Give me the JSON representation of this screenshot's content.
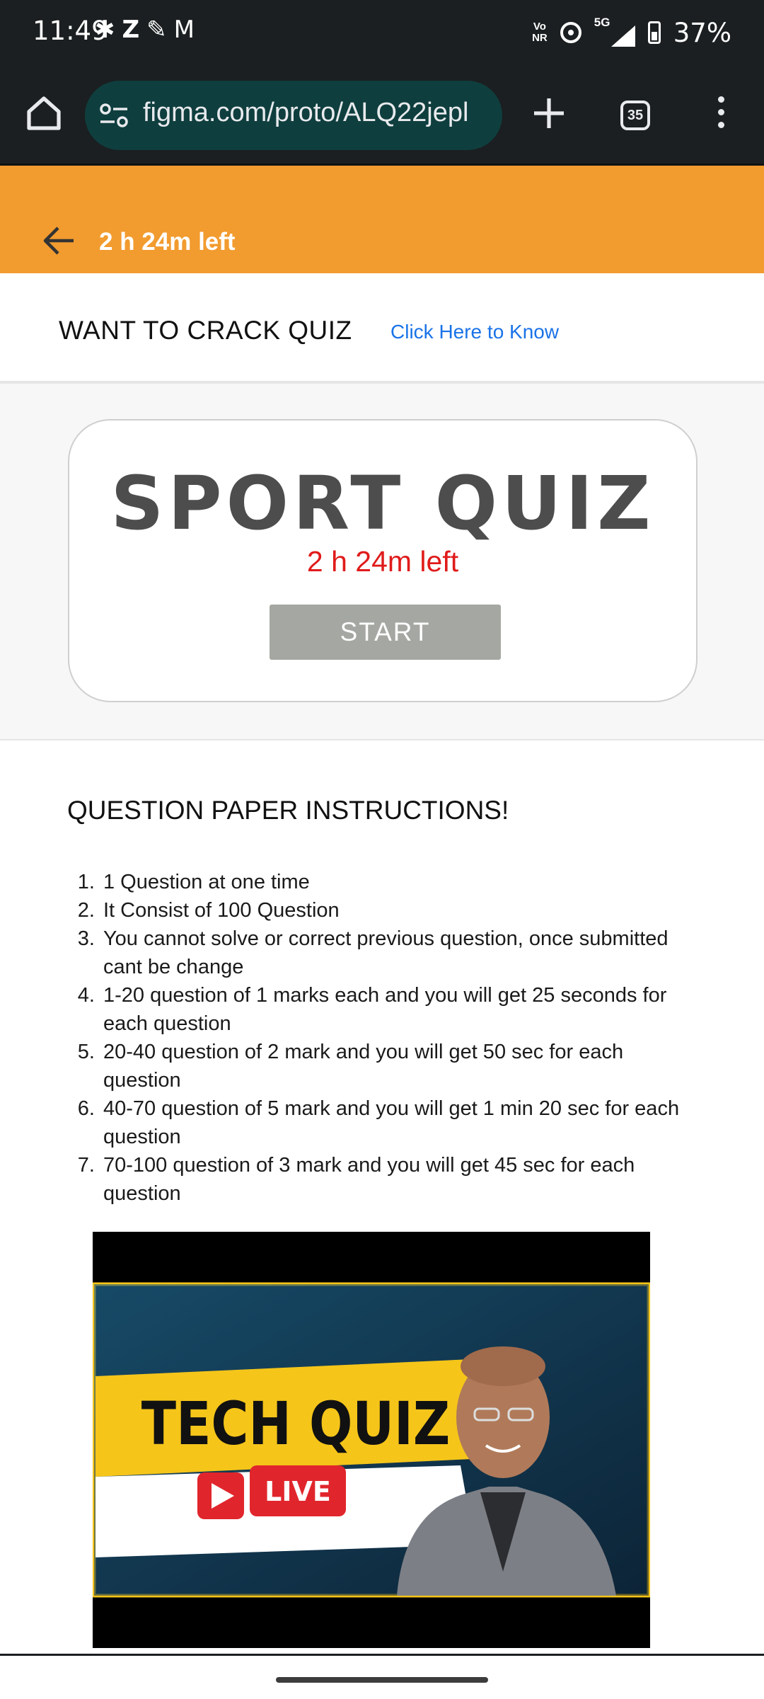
{
  "status_bar": {
    "time": "11:49",
    "notif_icons": [
      "slack-icon",
      "z-icon",
      "payment-icon",
      "gmail-icon"
    ],
    "volte": "Vo\nNR",
    "signal_label": "5G",
    "battery": "37%"
  },
  "browser": {
    "url": "figma.com/proto/ALQ22jepl",
    "tab_count": "35"
  },
  "header": {
    "time_left": "2 h 24m left"
  },
  "promo": {
    "title": "WANT TO CRACK QUIZ",
    "link": "Click Here to Know"
  },
  "quiz_card": {
    "title": "SPORT QUIZ",
    "time_left": "2 h 24m left",
    "start_label": "START"
  },
  "instructions": {
    "title": "QUESTION PAPER INSTRUCTIONS!",
    "items": [
      "1 Question at one time",
      "It Consist of 100 Question",
      "You cannot solve or correct previous question, once submitted cant be change",
      "1-20 question of 1 marks each and you will get 25 seconds for each question",
      "20-40 question of 2 mark and you will get 50 sec for each question",
      "40-70 question of 5 mark and you will get 1 min 20 sec for each question",
      "70-100 question of 3 mark and you will get 45 sec for each question"
    ]
  },
  "video": {
    "title_text": "TECH QUIZ",
    "badge": "LIVE"
  },
  "colors": {
    "header_orange": "#f29b2f",
    "timer_red": "#e01b1b",
    "link_blue": "#1a73e8",
    "start_gray": "#a4a7a2",
    "thumb_yellow": "#f5c51a",
    "live_red": "#e0262c"
  }
}
